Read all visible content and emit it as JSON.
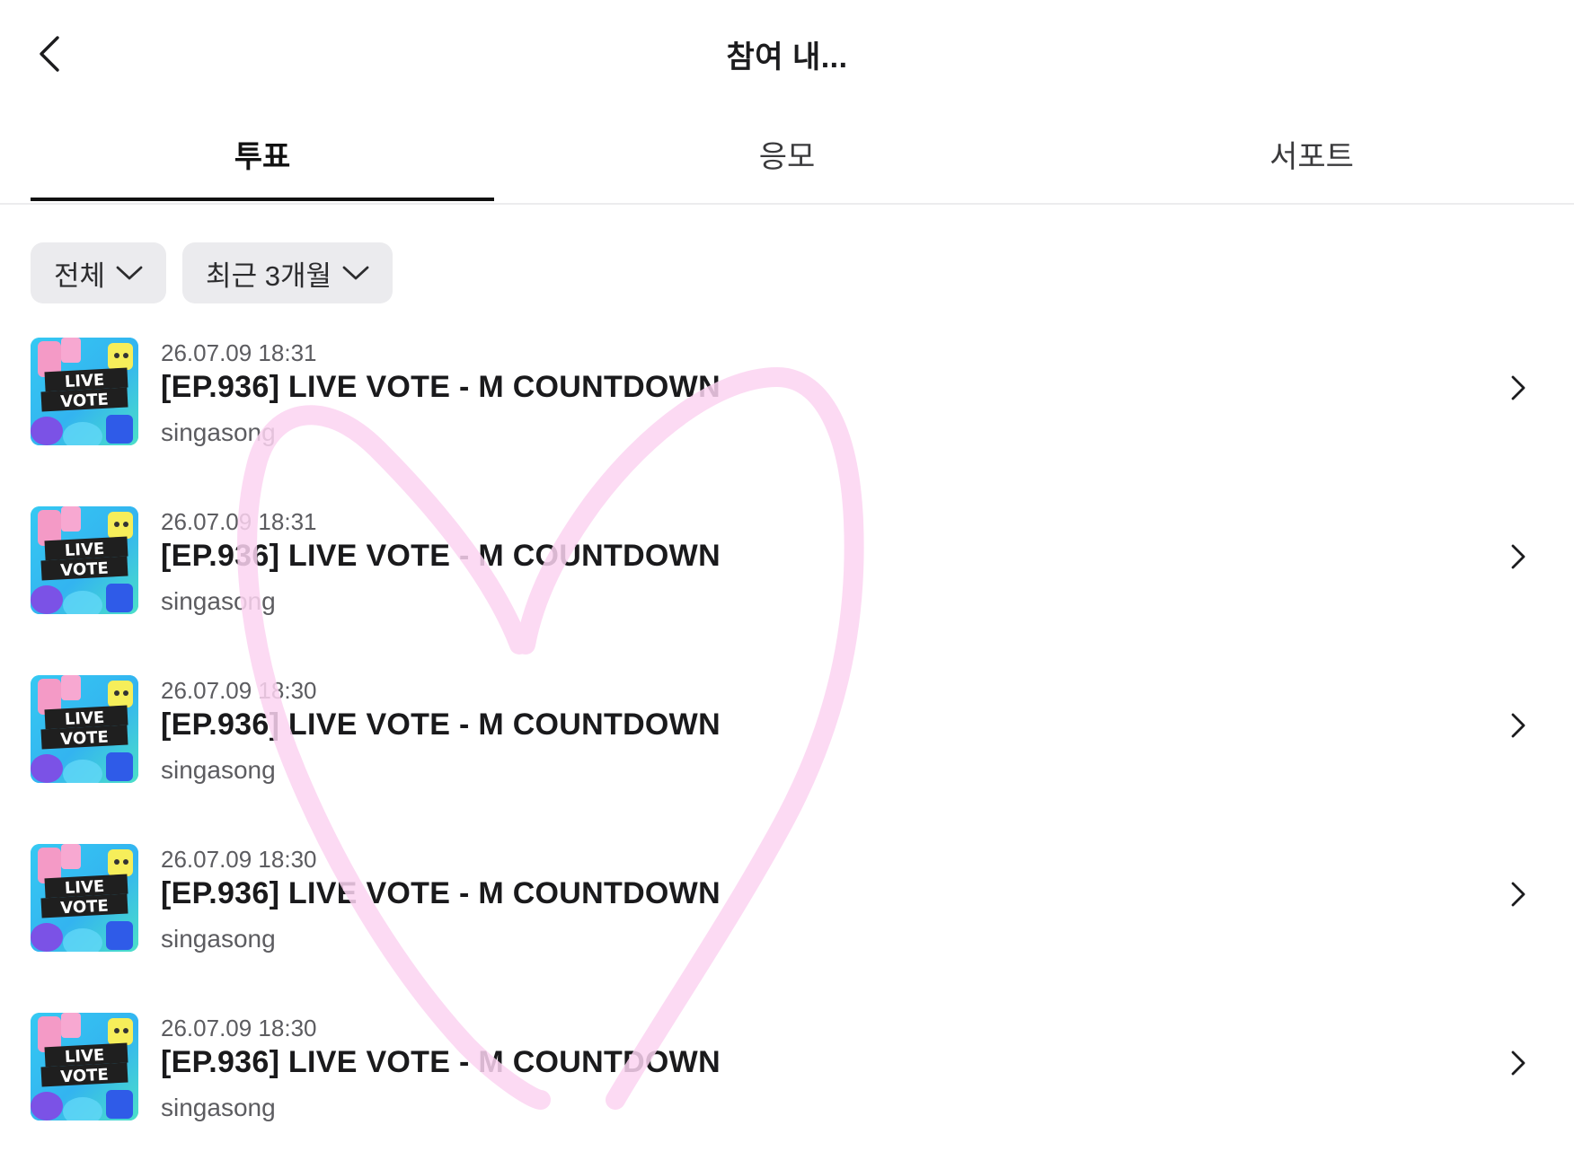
{
  "header": {
    "title": "참여 내...",
    "back_icon": "chevron-left-icon"
  },
  "tabs": [
    {
      "label": "투표",
      "active": true
    },
    {
      "label": "응모",
      "active": false
    },
    {
      "label": "서포트",
      "active": false
    }
  ],
  "filters": [
    {
      "label": "전체",
      "icon": "chevron-down-icon"
    },
    {
      "label": "최근 3개월",
      "icon": "chevron-down-icon"
    }
  ],
  "items": [
    {
      "date": "26.07.09 18:31",
      "title": "[EP.936] LIVE VOTE - M COUNTDOWN",
      "subtitle": "singasong",
      "thumb_line1": "LIVE",
      "thumb_line2": "VOTE"
    },
    {
      "date": "26.07.09 18:31",
      "title": "[EP.936] LIVE VOTE - M COUNTDOWN",
      "subtitle": "singasong",
      "thumb_line1": "LIVE",
      "thumb_line2": "VOTE"
    },
    {
      "date": "26.07.09 18:30",
      "title": "[EP.936] LIVE VOTE - M COUNTDOWN",
      "subtitle": "singasong",
      "thumb_line1": "LIVE",
      "thumb_line2": "VOTE"
    },
    {
      "date": "26.07.09 18:30",
      "title": "[EP.936] LIVE VOTE - M COUNTDOWN",
      "subtitle": "singasong",
      "thumb_line1": "LIVE",
      "thumb_line2": "VOTE"
    },
    {
      "date": "26.07.09 18:30",
      "title": "[EP.936] LIVE VOTE - M COUNTDOWN",
      "subtitle": "singasong",
      "thumb_line1": "LIVE",
      "thumb_line2": "VOTE"
    }
  ],
  "colors": {
    "accent": "#111111",
    "chip_bg": "#ebebee",
    "heart_stroke": "#fbd3f1"
  }
}
